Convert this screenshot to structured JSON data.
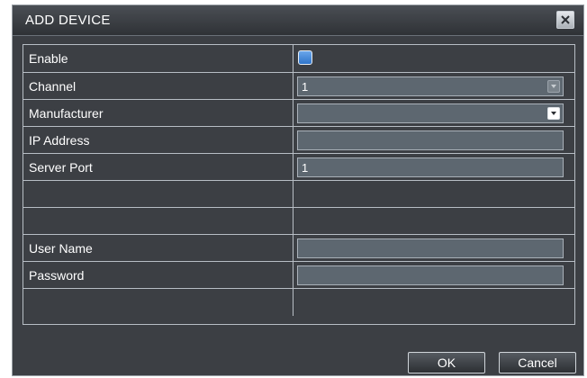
{
  "dialog": {
    "title": "ADD DEVICE",
    "close_icon": "close-x-icon"
  },
  "form": {
    "enable": {
      "label": "Enable",
      "checked": true
    },
    "channel": {
      "label": "Channel",
      "value": "1"
    },
    "manufacturer": {
      "label": "Manufacturer",
      "value": ""
    },
    "ip_address": {
      "label": "IP Address",
      "value": ""
    },
    "server_port": {
      "label": "Server Port",
      "value": "1"
    },
    "user_name": {
      "label": "User Name",
      "value": ""
    },
    "password": {
      "label": "Password",
      "value": ""
    }
  },
  "buttons": {
    "ok": "OK",
    "cancel": "Cancel"
  },
  "colors": {
    "dialog_bg": "#3c3f44",
    "field_bg": "#5d6770",
    "checkbox": "#3b82d6"
  }
}
